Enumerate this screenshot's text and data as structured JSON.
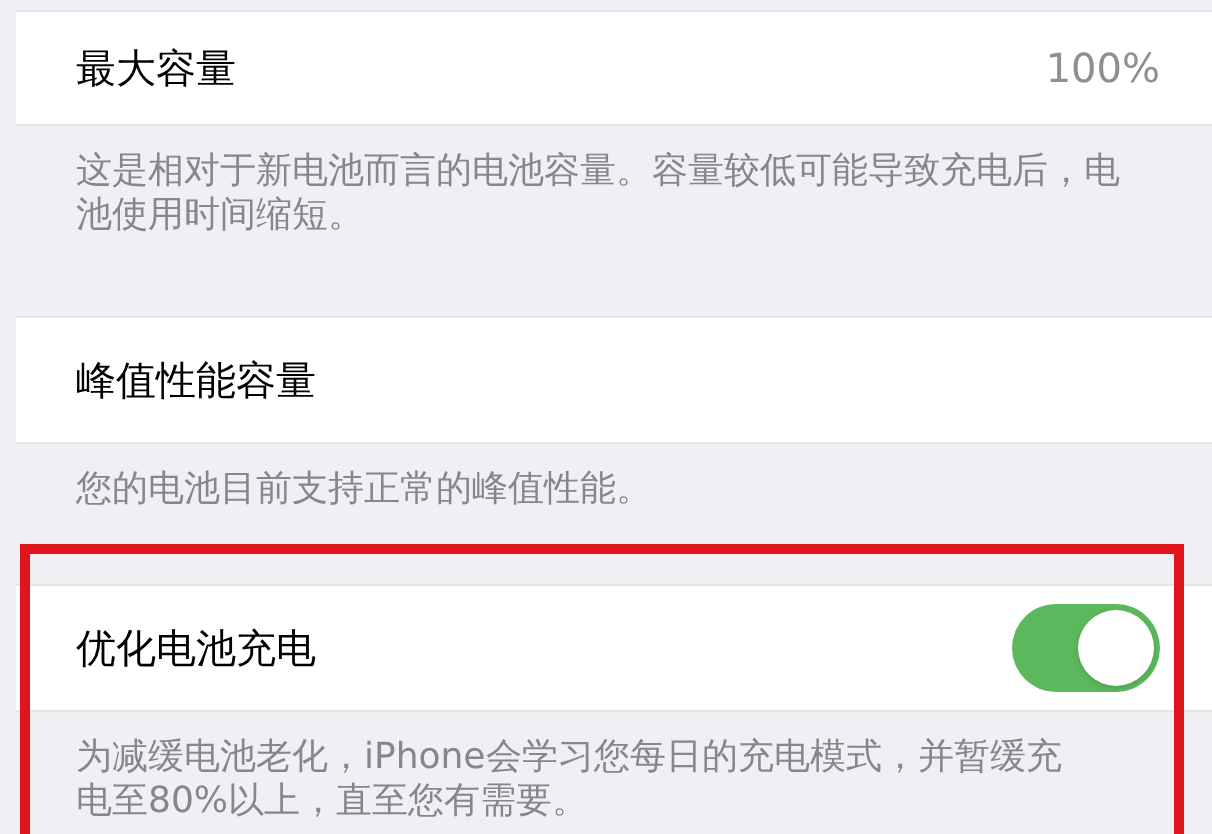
{
  "sections": [
    {
      "kind": "value",
      "title": "最大容量",
      "value": "100%",
      "footer": "这是相对于新电池而言的电池容量。容量较低可能导致充电后，电池使用时间缩短。",
      "highlighted": false
    },
    {
      "kind": "plain",
      "title": "峰值性能容量",
      "footer": "您的电池目前支持正常的峰值性能。",
      "highlighted": false
    },
    {
      "kind": "toggle",
      "title": "优化电池充电",
      "on": true,
      "footer": "为减缓电池老化，iPhone会学习您每日的充电模式，并暂缓充电至80%以上，直至您有需要。",
      "highlighted": true
    }
  ]
}
